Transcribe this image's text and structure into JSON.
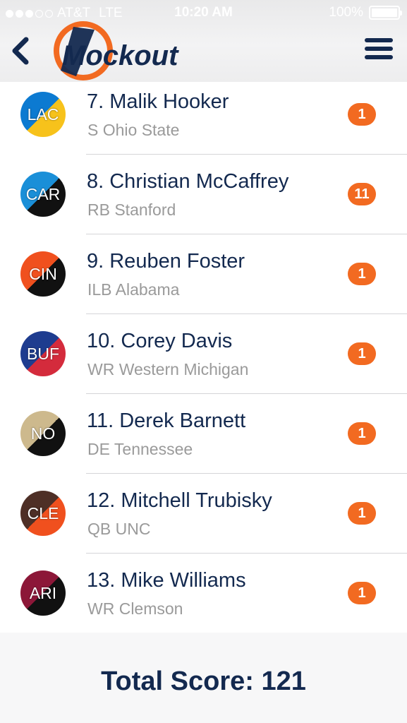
{
  "status_bar": {
    "carrier": "AT&T",
    "network": "LTE",
    "time": "10:20 AM",
    "battery": "100%"
  },
  "header": {
    "logo_text": "Mockout",
    "back_icon": "chevron-left-icon",
    "menu_icon": "hamburger-menu-icon"
  },
  "colors": {
    "navy": "#13294f",
    "orange": "#f26a21",
    "muted": "#9a9a9a"
  },
  "picks": [
    {
      "team": "LAC",
      "name": "7. Malik Hooker",
      "info": "S Ohio State",
      "score": "1",
      "c1": "#0c7ad1",
      "c2": "#f7c21b"
    },
    {
      "team": "CAR",
      "name": "8. Christian McCaffrey",
      "info": "RB Stanford",
      "score": "11",
      "c1": "#1a8fd8",
      "c2": "#111111"
    },
    {
      "team": "CIN",
      "name": "9. Reuben Foster",
      "info": "ILB Alabama",
      "score": "1",
      "c1": "#f0501e",
      "c2": "#111111"
    },
    {
      "team": "BUF",
      "name": "10. Corey Davis",
      "info": "WR Western Michigan",
      "score": "1",
      "c1": "#1e3c8f",
      "c2": "#d42b3c"
    },
    {
      "team": "NO",
      "name": "11. Derek Barnett",
      "info": "DE Tennessee",
      "score": "1",
      "c1": "#cdb98d",
      "c2": "#111111"
    },
    {
      "team": "CLE",
      "name": "12. Mitchell Trubisky",
      "info": "QB UNC",
      "score": "1",
      "c1": "#4e2f26",
      "c2": "#f0501e"
    },
    {
      "team": "ARI",
      "name": "13. Mike Williams",
      "info": "WR Clemson",
      "score": "1",
      "c1": "#8c1738",
      "c2": "#111111"
    }
  ],
  "total_score": "Total Score: 121"
}
